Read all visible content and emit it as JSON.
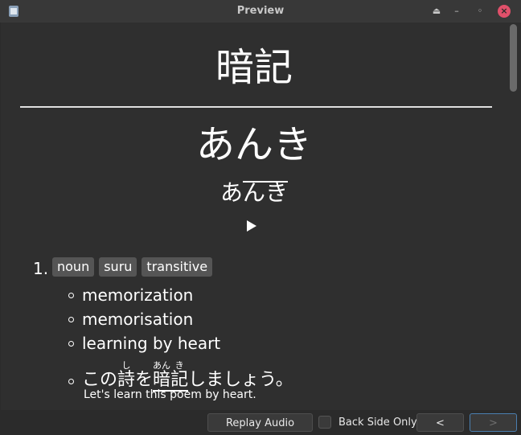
{
  "window": {
    "title": "Preview",
    "buttons": {
      "eject": "⏏",
      "minimize": "–",
      "maximize": "◦",
      "close": "×"
    }
  },
  "card": {
    "expression": "暗記",
    "reading": "あんき",
    "pitch": {
      "low": "あ",
      "high": "んき"
    },
    "play_symbol": "▶",
    "sense": {
      "number": "1.",
      "tags": [
        "noun",
        "suru",
        "transitive"
      ],
      "glosses": [
        "memorization",
        "memorisation",
        "learning by heart"
      ]
    },
    "example": {
      "before": "この",
      "ruby_word": "詩",
      "ruby_reading": "し",
      "particle": "を",
      "highlight_ruby": [
        {
          "kanji": "暗",
          "reading": "あん"
        },
        {
          "kanji": "記",
          "reading": "き"
        }
      ],
      "after": "しましょう。",
      "translation": "Let's learn this poem by heart."
    }
  },
  "controls": {
    "replay_label": "Replay Audio",
    "back_side_only_label": "Back Side Only",
    "back_side_only_checked": false,
    "prev_label": "<",
    "next_label": ">"
  },
  "colors": {
    "background": "#2f2f2f",
    "titlebar": "#383838",
    "close_button": "#e0506a",
    "tag_background": "#555555",
    "focus_border": "#4a7fb0"
  }
}
